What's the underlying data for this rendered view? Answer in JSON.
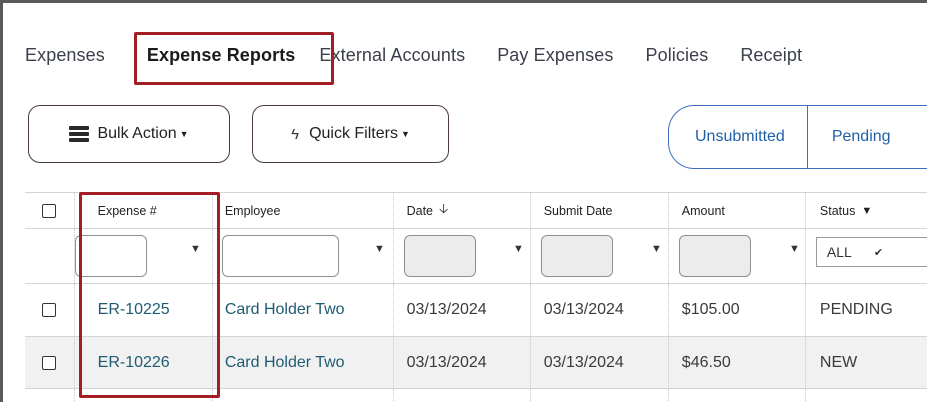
{
  "tabs": [
    "Expenses",
    "Expense Reports",
    "External Accounts",
    "Pay Expenses",
    "Policies",
    "Receipt"
  ],
  "toolbar": {
    "bulk_action": "Bulk Action",
    "quick_filters": "Quick Filters"
  },
  "segments": [
    "Unsubmitted",
    "Pending"
  ],
  "table": {
    "headers": [
      "Expense #",
      "Employee",
      "Date",
      "Submit Date",
      "Amount",
      "Status"
    ],
    "status_filter": "ALL",
    "rows": [
      [
        "ER-10225",
        "Card Holder Two",
        "03/13/2024",
        "03/13/2024",
        "$105.00",
        "PENDING"
      ],
      [
        "ER-10226",
        "Card Holder Two",
        "03/13/2024",
        "03/13/2024",
        "$46.50",
        "NEW"
      ]
    ]
  },
  "colors": {
    "highlight": "#a51d24",
    "link": "#1e5b73",
    "segment": "#3c6fc0"
  },
  "icons": [
    "bulk-action-icon",
    "lightning-icon",
    "sort-down-icon",
    "filter-icon",
    "chevron-down-icon"
  ]
}
